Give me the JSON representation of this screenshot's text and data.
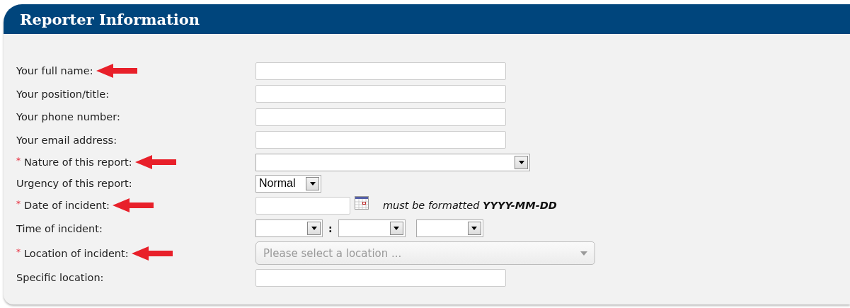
{
  "panel": {
    "title": "Reporter Information"
  },
  "rows": [
    {
      "kind": "text",
      "label": "Your full name:",
      "arrow": true
    },
    {
      "kind": "text",
      "label": "Your position/title:",
      "arrow": false
    },
    {
      "kind": "text",
      "label": "Your phone number:",
      "arrow": false
    },
    {
      "kind": "text",
      "label": "Your email address:",
      "arrow": false
    },
    {
      "kind": "select",
      "label": "Nature of this report:",
      "required_mark": "*",
      "arrow": true
    },
    {
      "kind": "small-select",
      "label": "Urgency of this report:",
      "value": "Normal",
      "arrow": false
    },
    {
      "kind": "date",
      "label": "Date of incident:",
      "required_mark": "*",
      "arrow": true,
      "hint": "must be formatted **YYYY-MM-DD**"
    },
    {
      "kind": "time",
      "label": "Time of incident:",
      "separator": ":",
      "arrow": false
    },
    {
      "kind": "location",
      "label": "Location of incident:",
      "required_mark": "*",
      "arrow": true,
      "placeholder": "Please select a location ..."
    },
    {
      "kind": "text",
      "label": "Specific location:",
      "arrow": false
    }
  ]
}
